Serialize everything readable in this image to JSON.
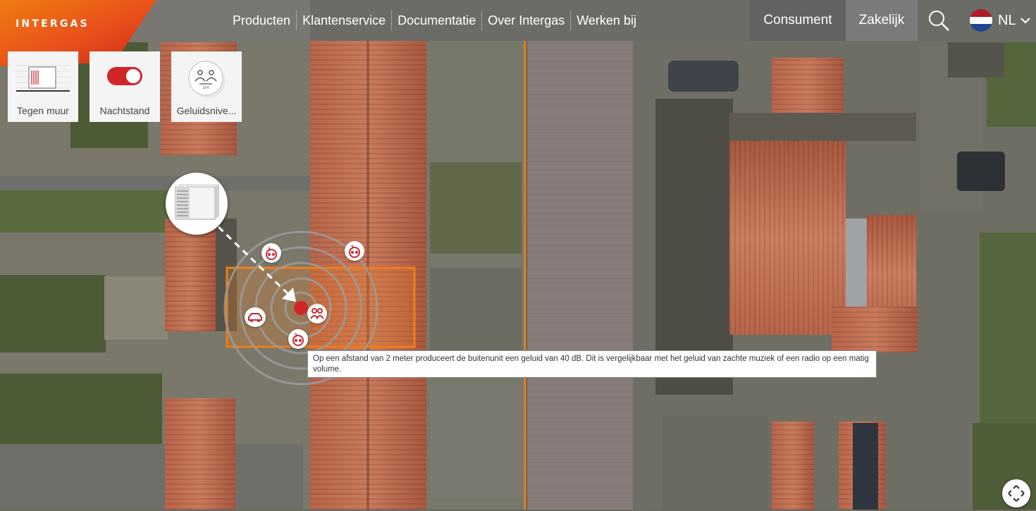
{
  "brand": {
    "logo_text": "INTERGAS",
    "color": "#e8501b"
  },
  "nav": {
    "items": [
      "Producten",
      "Klantenservice",
      "Documentatie",
      "Over Intergas",
      "Werken bij"
    ]
  },
  "segments": {
    "consumer": "Consument",
    "business": "Zakelijk",
    "active": "Consument"
  },
  "language": {
    "label": "NL",
    "flag": "netherlands-flag"
  },
  "tools": [
    {
      "label": "Tegen muur",
      "icon": "wall-unit-icon"
    },
    {
      "label": "Nachtstand",
      "icon": "toggle-switch",
      "state": "on"
    },
    {
      "label": "Geluidsnive...",
      "icon": "sound-level-icon"
    }
  ],
  "map": {
    "heat_pump_bubble_icon": "heat-pump-outdoor-unit-icon",
    "sound_ring_count": 5,
    "accent_color": "#d0262a",
    "plot_outline_color": "#ef7f1a"
  },
  "tooltip": {
    "text": "Op een afstand van 2 meter produceert de buitenunit een geluid van 40 dB. Dit is vergelijkbaar met het geluid van zachte muziek of een radio op een matig volume."
  },
  "controls": {
    "recenter_icon": "recenter-arrows-icon"
  }
}
